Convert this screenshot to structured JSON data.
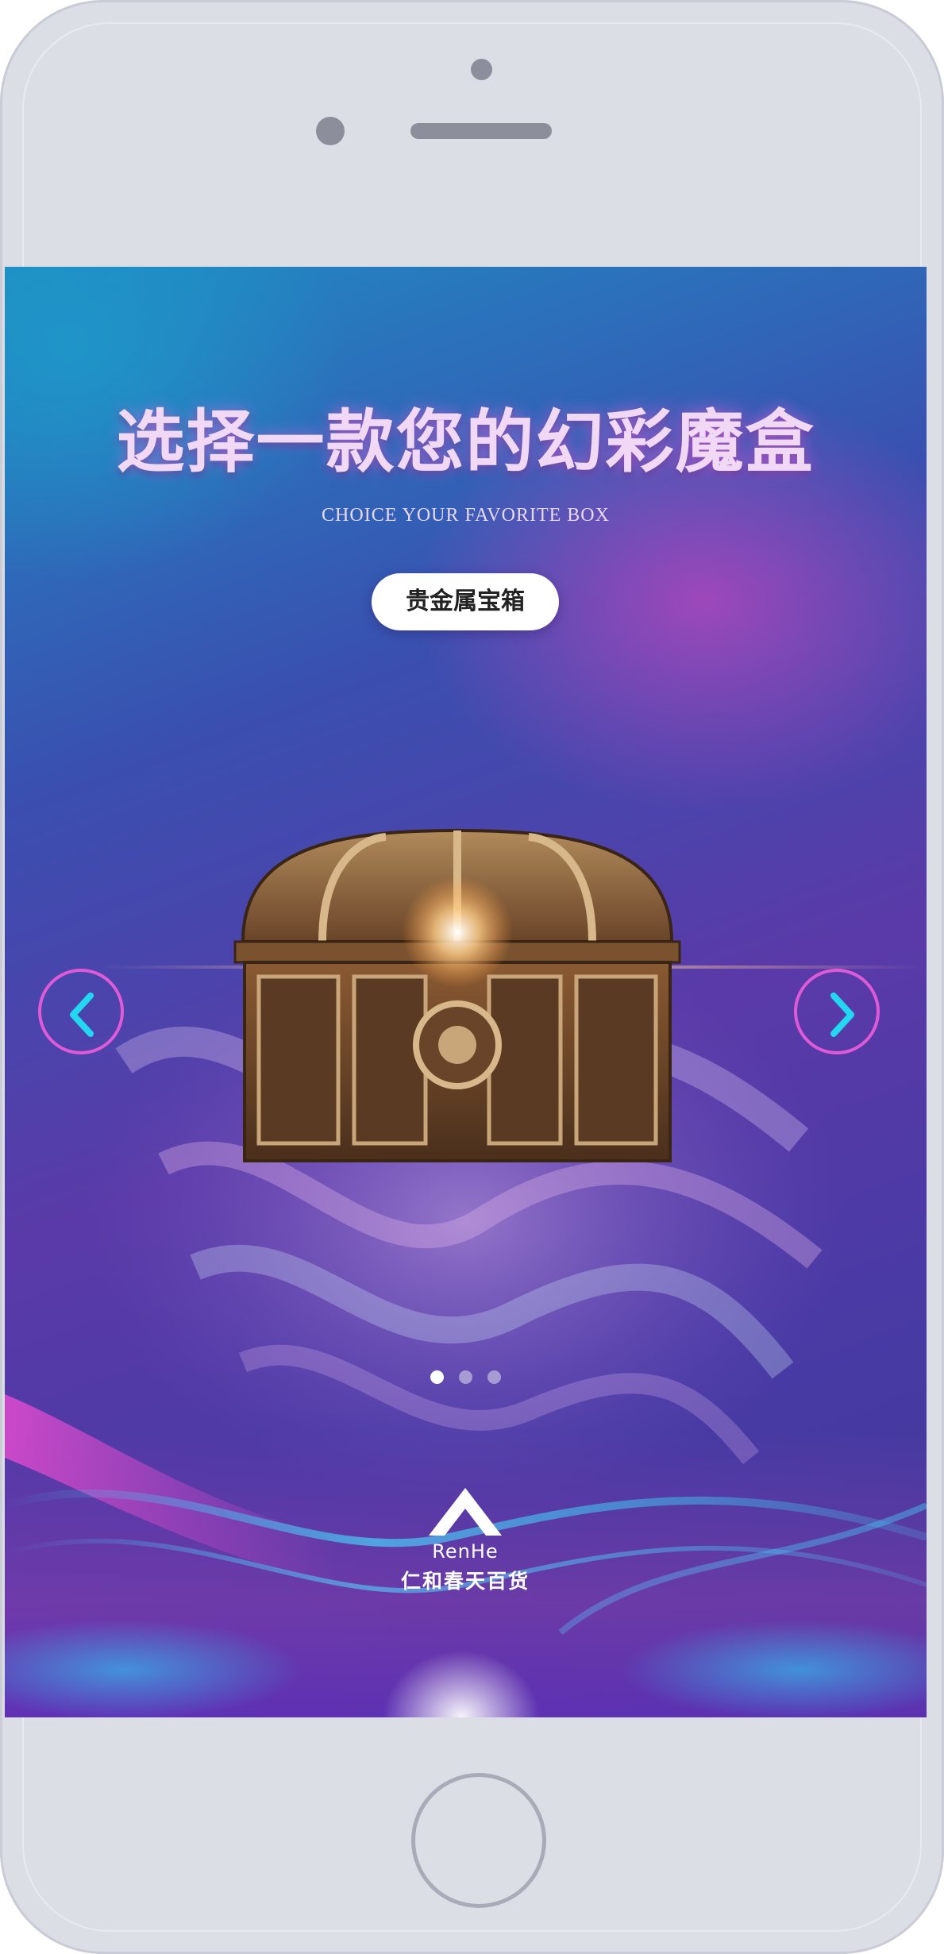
{
  "page": {
    "title_cn": "选择一款您的幻彩魔盒",
    "title_en": "CHOICE YOUR FAVORITE BOX",
    "current_box": "贵金属宝箱"
  },
  "carousel": {
    "prev_icon": "chevron-left-icon",
    "next_icon": "chevron-right-icon",
    "slide_count": 3,
    "active_index": 0
  },
  "brand": {
    "logo_latin": "RenHe",
    "logo_cn": "仁和春天百货"
  },
  "colors": {
    "accent_pink": "#e05ad8",
    "accent_cyan": "#22d7f0",
    "phone_frame": "#dcdee6"
  }
}
